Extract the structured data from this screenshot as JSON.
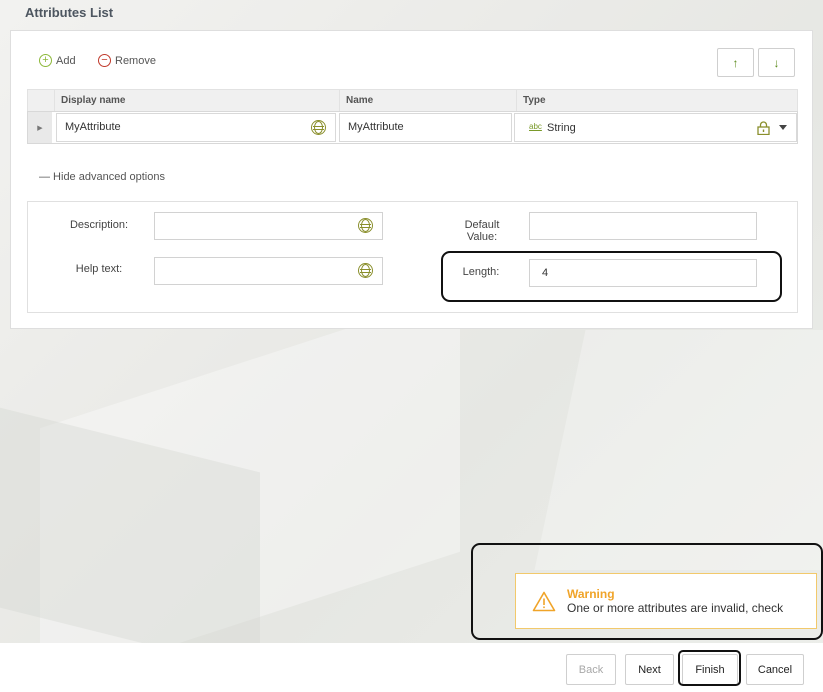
{
  "section": {
    "title": "Attributes List"
  },
  "toolbar": {
    "add_label": "Add",
    "remove_label": "Remove",
    "move_up_glyph": "↑",
    "move_down_glyph": "↓"
  },
  "grid": {
    "columns": [
      "Display name",
      "Name",
      "Type"
    ],
    "rows": [
      {
        "display_name": "MyAttribute",
        "name": "MyAttribute",
        "type_icon": "abc",
        "type": "String"
      }
    ]
  },
  "advanced": {
    "toggle_label": "— Hide advanced options",
    "description_label": "Description:",
    "description_value": "",
    "help_text_label": "Help text:",
    "help_text_value": "",
    "default_value_label": "Default Value:",
    "default_value_value": "",
    "length_label": "Length:",
    "length_value": "4"
  },
  "warning": {
    "title": "Warning",
    "message": "One or more attributes are invalid, check"
  },
  "footer": {
    "back_label": "Back",
    "next_label": "Next",
    "finish_label": "Finish",
    "cancel_label": "Cancel"
  },
  "colors": {
    "accent_green": "#8db83a",
    "remove_red": "#c0392b",
    "warning_orange": "#f0a429",
    "title_text": "#4d5660"
  },
  "icons": [
    "add-circle-icon",
    "remove-circle-icon",
    "arrow-up-icon",
    "arrow-down-icon",
    "row-marker-icon",
    "globe-icon",
    "abc-type-icon",
    "lock-icon",
    "dropdown-caret-icon",
    "warning-triangle-icon"
  ]
}
